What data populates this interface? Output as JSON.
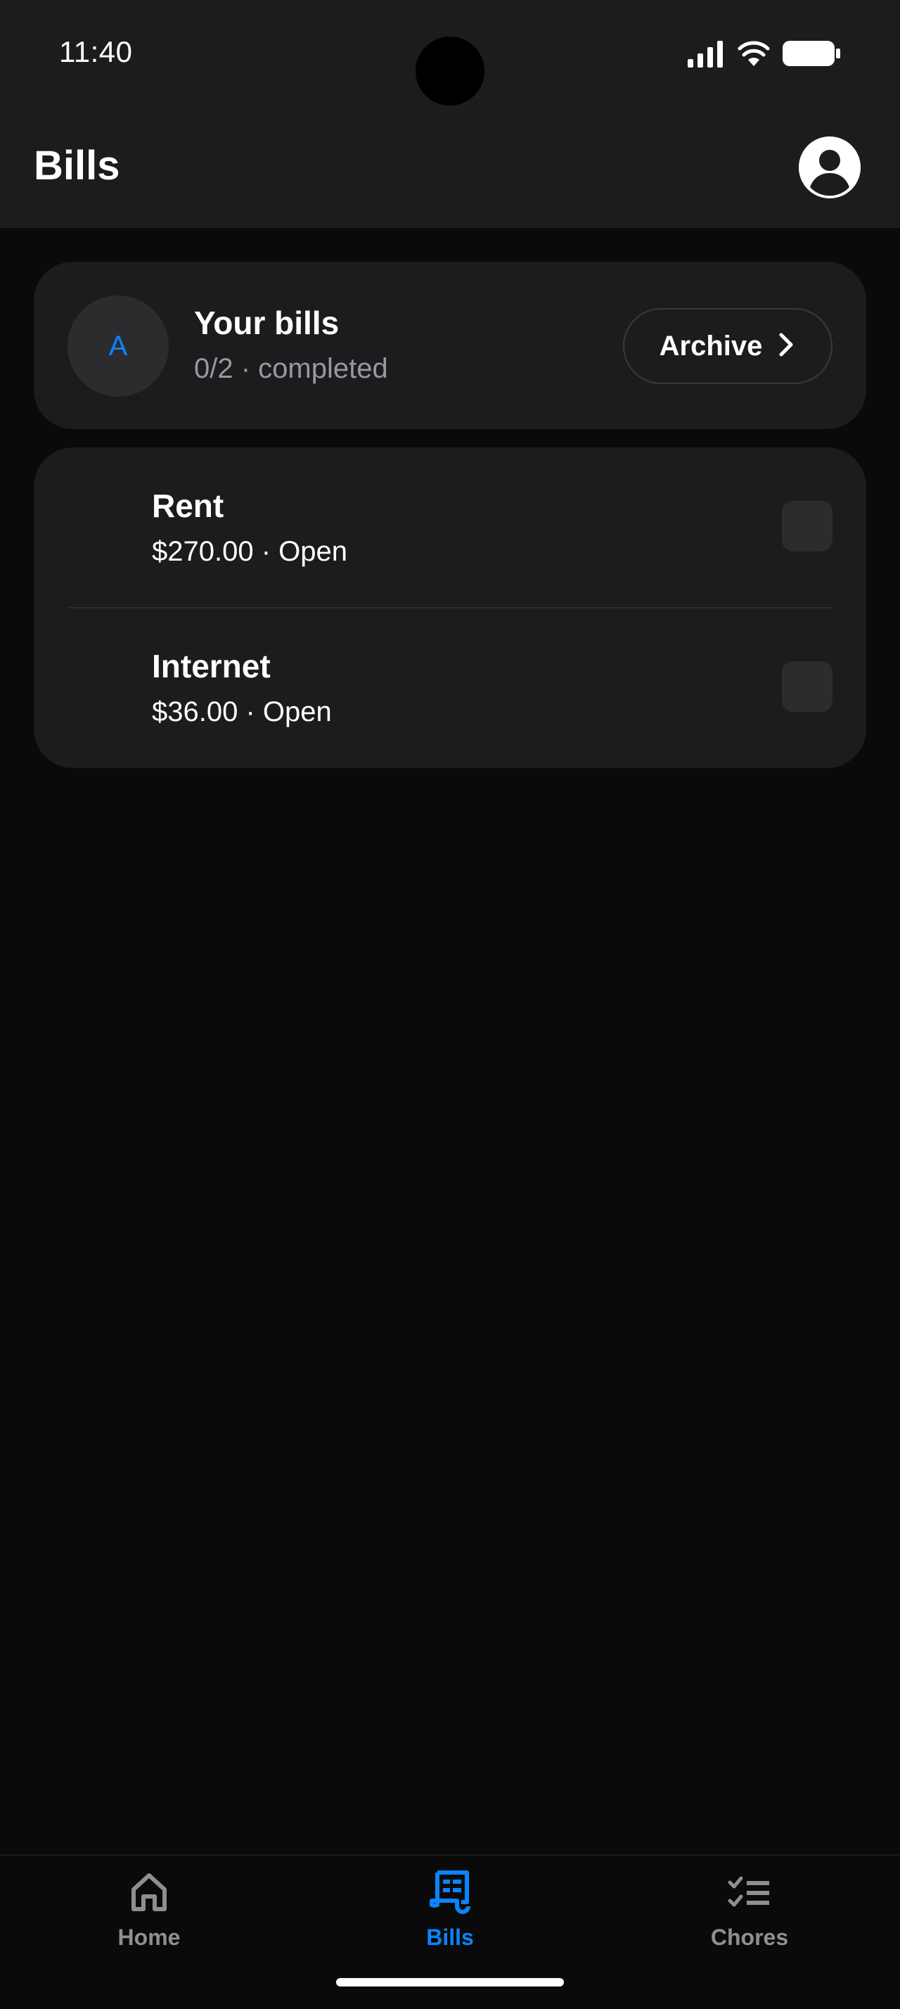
{
  "status_bar": {
    "time": "11:40",
    "icons": [
      "signal-icon",
      "wifi-icon",
      "battery-icon"
    ]
  },
  "header": {
    "title": "Bills",
    "profile_icon": "account-circle-icon"
  },
  "summary": {
    "avatar_letter": "A",
    "title": "Your bills",
    "subtitle": "0/2 · completed",
    "archive_label": "Archive",
    "archive_icon": "chevron-right-icon"
  },
  "bills": [
    {
      "name": "Rent",
      "meta": "$270.00 · Open",
      "checked": false
    },
    {
      "name": "Internet",
      "meta": "$36.00 · Open",
      "checked": false
    }
  ],
  "nav": {
    "items": [
      {
        "label": "Home",
        "icon": "home-icon",
        "active": false
      },
      {
        "label": "Bills",
        "icon": "receipt-icon",
        "active": true
      },
      {
        "label": "Chores",
        "icon": "checklist-icon",
        "active": false
      }
    ]
  },
  "colors": {
    "accent": "#0a84ff",
    "background": "#0a0a0a",
    "surface": "#1c1c1e",
    "muted_text": "#98989d",
    "inactive_nav": "#8e8e93"
  }
}
